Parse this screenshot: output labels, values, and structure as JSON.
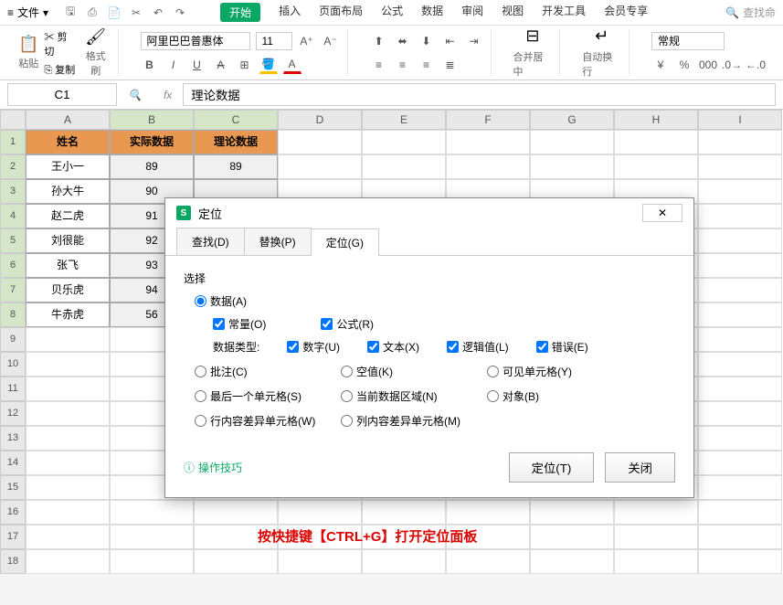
{
  "menu": {
    "file": "文件",
    "search": "查找命"
  },
  "tabs": [
    "开始",
    "插入",
    "页面布局",
    "公式",
    "数据",
    "审阅",
    "视图",
    "开发工具",
    "会员专享"
  ],
  "active_tab": 0,
  "ribbon": {
    "paste": "粘贴",
    "cut": "剪切",
    "copy": "复制",
    "formatpaint": "格式刷",
    "font_name": "阿里巴巴普惠体",
    "font_size": "11",
    "merge": "合并居中",
    "wrap": "自动换行",
    "numfmt": "常规"
  },
  "cell_ref": "C1",
  "formula_value": "理论数据",
  "columns": [
    "A",
    "B",
    "C",
    "D",
    "E",
    "F",
    "G",
    "H",
    "I"
  ],
  "header_row": [
    "姓名",
    "实际数据",
    "理论数据"
  ],
  "data_rows": [
    {
      "name": "王小一",
      "actual": "89",
      "theory": "89"
    },
    {
      "name": "孙大牛",
      "actual": "90",
      "theory": ""
    },
    {
      "name": "赵二虎",
      "actual": "91",
      "theory": ""
    },
    {
      "name": "刘很能",
      "actual": "92",
      "theory": ""
    },
    {
      "name": "张飞",
      "actual": "93",
      "theory": ""
    },
    {
      "name": "贝乐虎",
      "actual": "94",
      "theory": ""
    },
    {
      "name": "牛赤虎",
      "actual": "56",
      "theory": ""
    }
  ],
  "dialog": {
    "title": "定位",
    "tabs": {
      "find": "查找(D)",
      "replace": "替换(P)",
      "goto": "定位(G)"
    },
    "select_label": "选择",
    "opts": {
      "data": "数据(A)",
      "const": "常量(O)",
      "formula": "公式(R)",
      "type_label": "数据类型:",
      "number": "数字(U)",
      "text": "文本(X)",
      "logic": "逻辑值(L)",
      "error": "错误(E)",
      "comment": "批注(C)",
      "blank": "空值(K)",
      "visible": "可见单元格(Y)",
      "last": "最后一个单元格(S)",
      "region": "当前数据区域(N)",
      "object": "对象(B)",
      "rowdiff": "行内容差异单元格(W)",
      "coldiff": "列内容差异单元格(M)"
    },
    "tips": "操作技巧",
    "btn_goto": "定位(T)",
    "btn_close": "关闭",
    "close_x": "✕"
  },
  "hint": "按快捷键【CTRL+G】打开定位面板"
}
